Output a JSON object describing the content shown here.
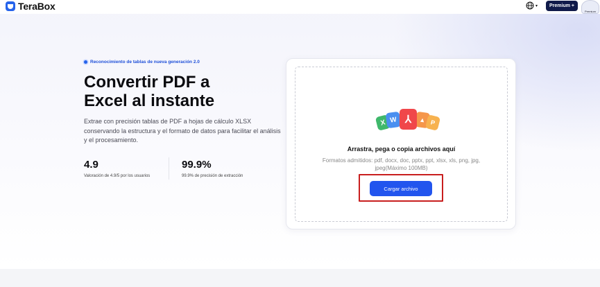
{
  "header": {
    "logo_text": "TeraBox",
    "lang_icon": "globe-icon",
    "premium_label": "Premium +",
    "avatar_label": "Premium"
  },
  "hero": {
    "badge": "Reconocimiento de tablas de nueva generación 2.0",
    "title_line1": "Convertir PDF a",
    "title_line2": "Excel al instante",
    "description": "Extrae con precisión tablas de PDF a hojas de cálculo XLSX conservando la estructura y el formato de datos para facilitar el análisis y el procesamiento.",
    "stats": [
      {
        "value": "4.9",
        "label": "Valoración de 4.9/5 por los usuarios"
      },
      {
        "value": "99.9%",
        "label": "99.9% de precisión de extracción"
      }
    ]
  },
  "upload": {
    "drop_title": "Arrastra, pega o copia archivos aquí",
    "formats": "Formatos admitidos: pdf, docx, doc, pptx, ppt, xlsx, xls, png, jpg, jpeg(Máximo 100MB)",
    "button_label": "Cargar archivo",
    "file_icons": [
      {
        "name": "excel-file-icon",
        "glyph": "X",
        "color": "#3fb86b"
      },
      {
        "name": "word-file-icon",
        "glyph": "W",
        "color": "#4a8ff0"
      },
      {
        "name": "pdf-file-icon",
        "glyph": "⅄",
        "color": "#f0474a"
      },
      {
        "name": "image-file-icon",
        "glyph": "▲",
        "color": "#f5964a"
      },
      {
        "name": "ppt-file-icon",
        "glyph": "P",
        "color": "#f7b24f"
      }
    ]
  },
  "colors": {
    "accent": "#2255ee",
    "premium": "#101a4a",
    "highlight_box": "#c81e1e"
  }
}
